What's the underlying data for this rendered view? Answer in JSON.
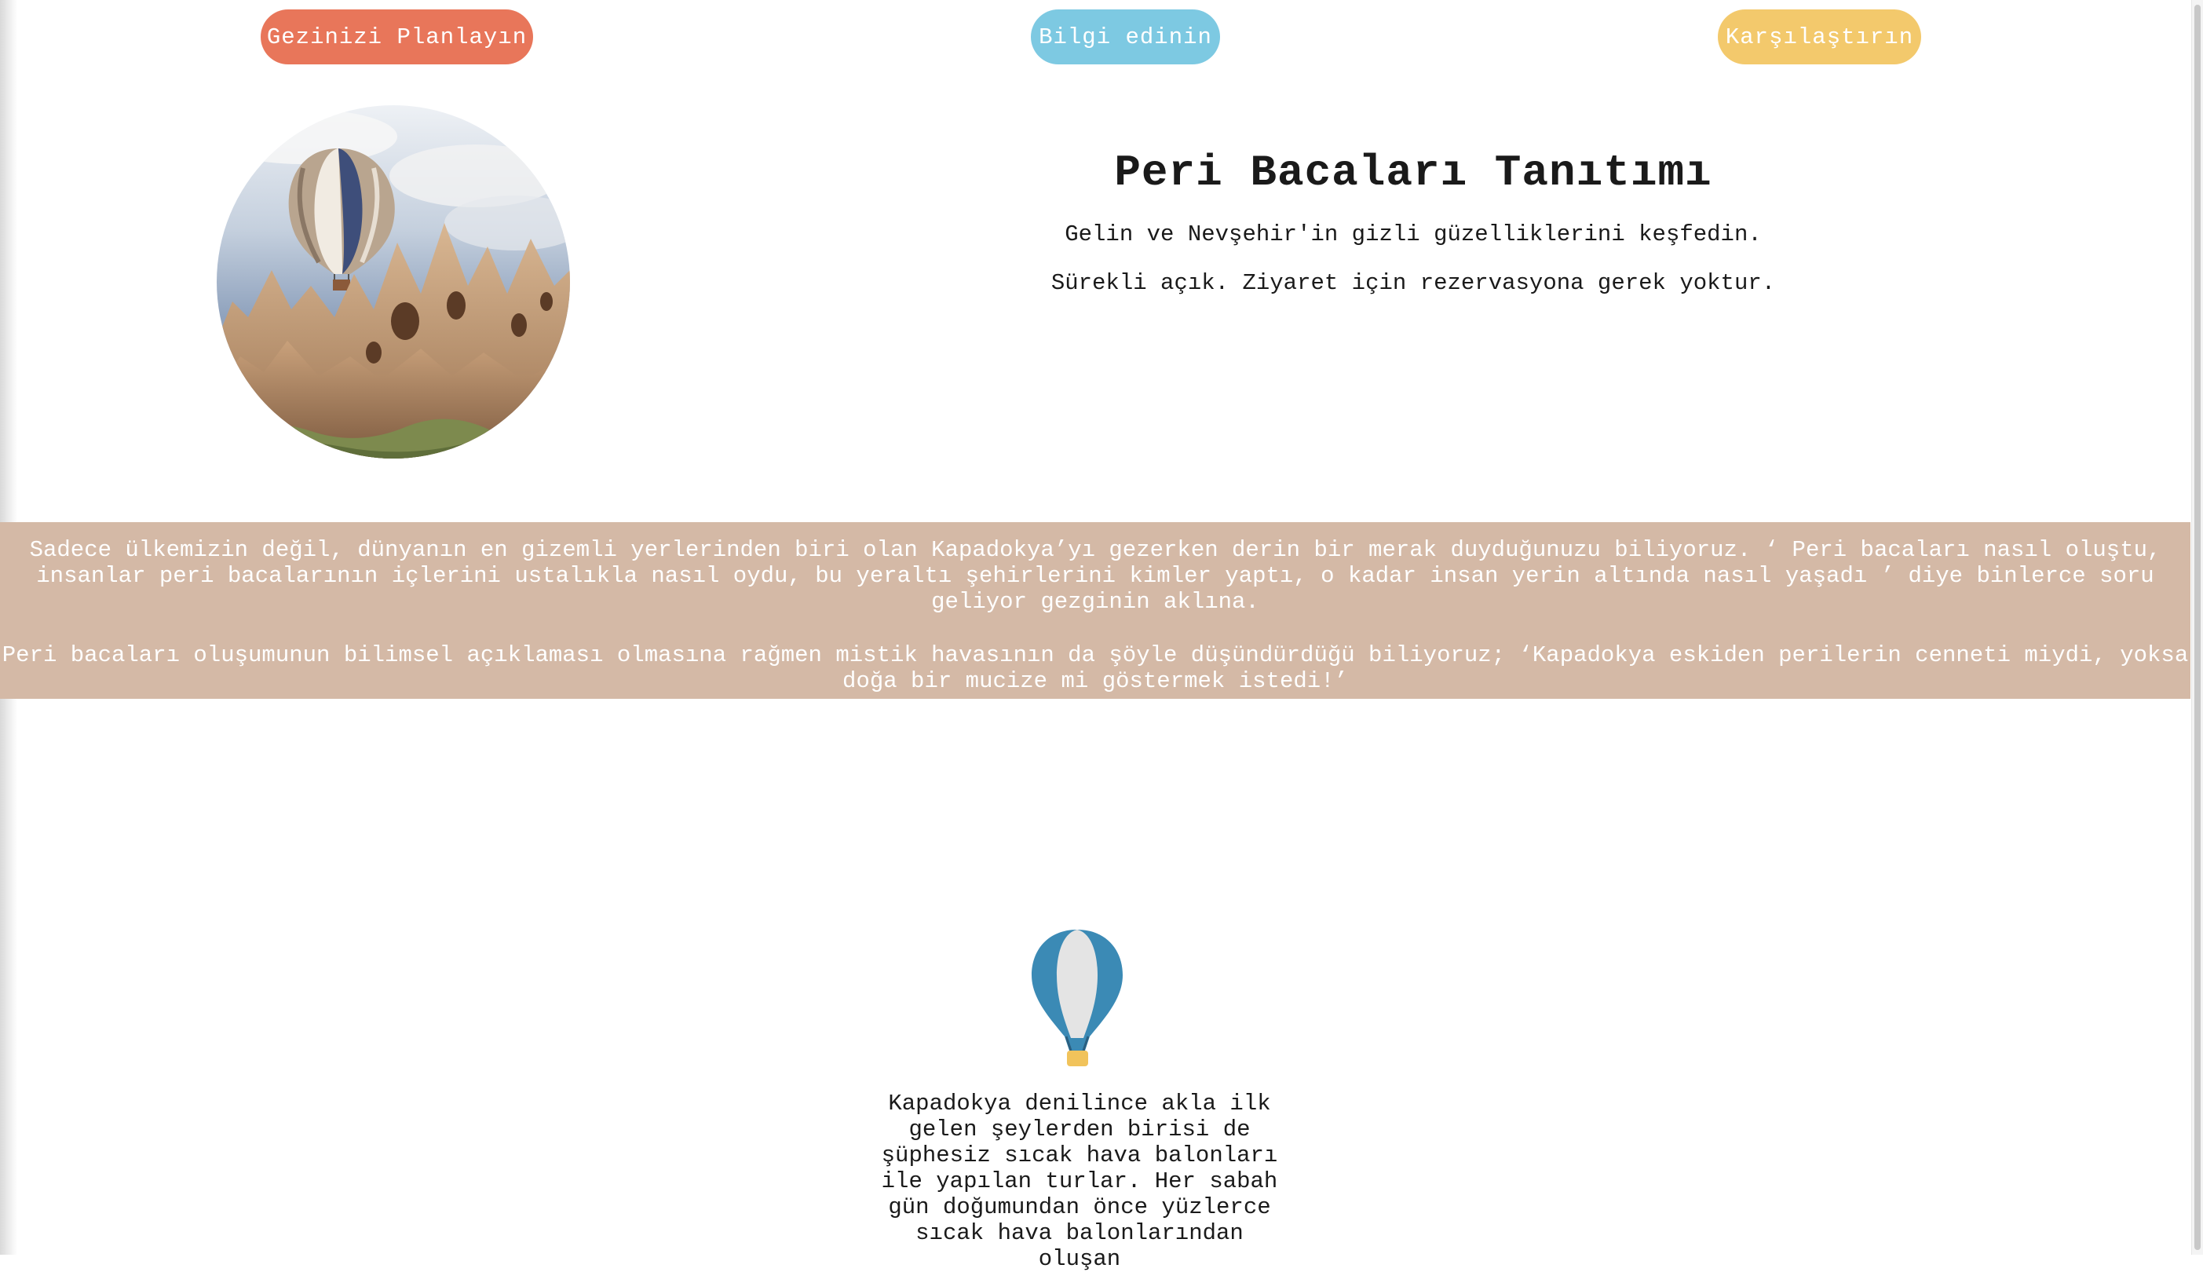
{
  "nav": {
    "plan_label": "Gezinizi Planlayın",
    "info_label": "Bilgi edinin",
    "compare_label": "Karşılaştırın"
  },
  "colors": {
    "plan_button": "#e8765a",
    "info_button": "#7dc9e2",
    "compare_button": "#f3c96c",
    "intro_band": "#d4b9a6",
    "balloon_blue": "#3b8ab5",
    "balloon_basket": "#f1c35b"
  },
  "hero": {
    "title": "Peri Bacaları Tanıtımı",
    "subtitle": "Gelin ve Nevşehir'in gizli güzelliklerini keşfedin.",
    "note": "Sürekli açık. Ziyaret için rezervasyona gerek yoktur."
  },
  "intro": {
    "paragraph_1": "Sadece ülkemizin değil, dünyanın en gizemli yerlerinden biri olan Kapadokya’yı gezerken derin bir merak duyduğunuzu biliyoruz. ‘ Peri bacaları nasıl oluştu, insanlar peri bacalarının içlerini ustalıkla nasıl oydu, bu yeraltı şehirlerini kimler yaptı, o kadar insan yerin altında nasıl yaşadı ’ diye binlerce soru geliyor gezginin aklına.",
    "paragraph_2": "Peri bacaları oluşumunun bilimsel açıklaması olmasına rağmen mistik havasının da şöyle düşündürdüğü biliyoruz; ‘Kapadokya eskiden perilerin cenneti miydi, yoksa doğa bir mucize mi göstermek istedi!’"
  },
  "balloon_section": {
    "icon": "hot-air-balloon-icon",
    "text": "Kapadokya denilince akla ilk gelen şeylerden birisi de şüphesiz sıcak hava balonları ile yapılan turlar. Her sabah gün doğumundan önce yüzlerce sıcak hava balonlarından oluşan"
  },
  "hero_image": {
    "icon": "cappadocia-balloon-photo"
  }
}
